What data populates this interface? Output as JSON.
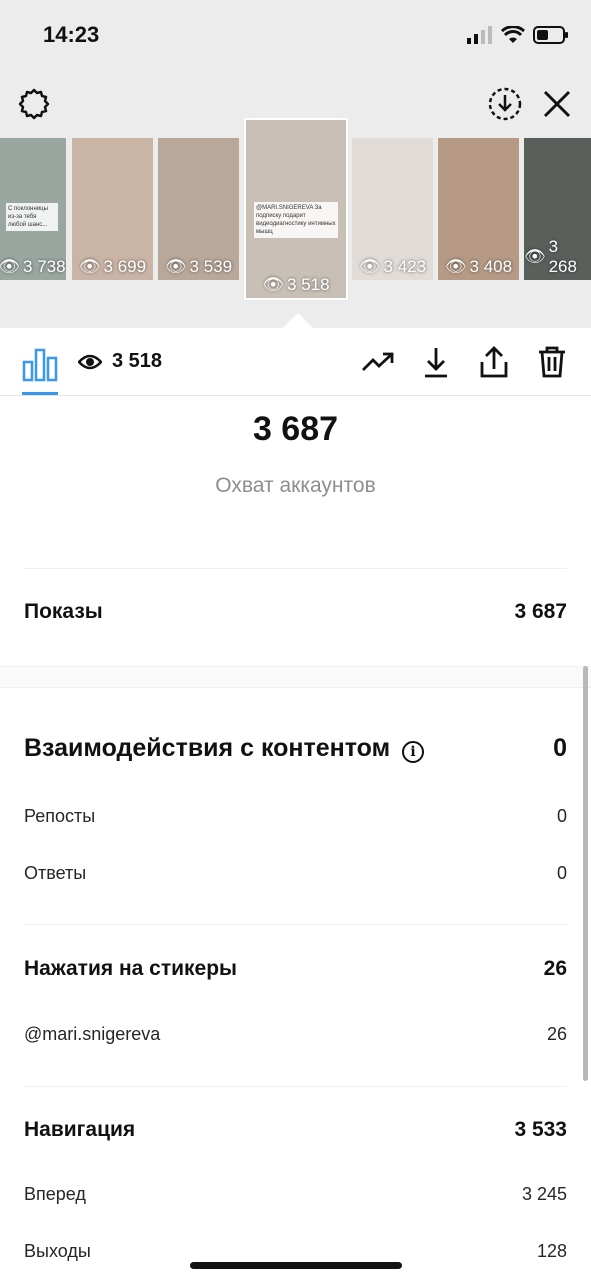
{
  "status_bar": {
    "time": "14:23"
  },
  "thumbnails": [
    {
      "views": "3 738",
      "bg": "#9aa6a0",
      "caption": "С поклонницы из-за тебя любой шанс..."
    },
    {
      "views": "3 699",
      "bg": "#c9b4a6",
      "caption": ""
    },
    {
      "views": "3 539",
      "bg": "#b9a89a",
      "caption": ""
    },
    {
      "views": "3 518",
      "bg": "#c8c0b6",
      "caption": "@MARI.SNIGEREVA  За подписку подарит видеодиагностику интимных мышц"
    },
    {
      "views": "3 423",
      "bg": "#e2dcd8",
      "caption": ""
    },
    {
      "views": "3 408",
      "bg": "#b69a86",
      "caption": ""
    },
    {
      "views": "3 268",
      "bg": "#5a5f5c",
      "caption": ""
    }
  ],
  "toolbar": {
    "views": "3 518"
  },
  "reach": {
    "value": "3 687",
    "label": "Охват аккаунтов"
  },
  "impressions": {
    "label": "Показы",
    "value": "3 687"
  },
  "interactions": {
    "label": "Взаимодействия с контентом",
    "value": "0",
    "info_icon": "i",
    "rows": [
      {
        "label": "Репосты",
        "value": "0"
      },
      {
        "label": "Ответы",
        "value": "0"
      }
    ]
  },
  "stickers": {
    "label": "Нажатия на стикеры",
    "value": "26",
    "rows": [
      {
        "label": "@mari.snigereva",
        "value": "26"
      }
    ]
  },
  "navigation": {
    "label": "Навигация",
    "value": "3 533",
    "rows": [
      {
        "label": "Вперед",
        "value": "3 245"
      },
      {
        "label": "Выходы",
        "value": "128"
      }
    ]
  }
}
